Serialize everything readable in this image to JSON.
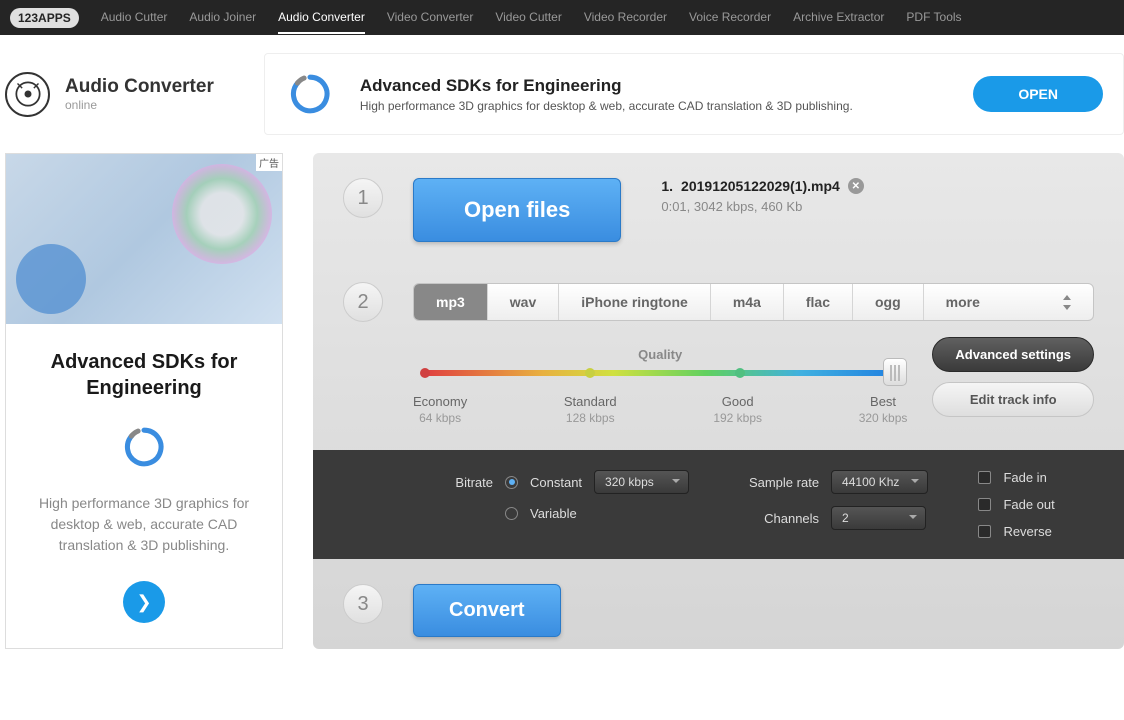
{
  "brand": "123APPS",
  "nav": [
    "Audio Cutter",
    "Audio Joiner",
    "Audio Converter",
    "Video Converter",
    "Video Cutter",
    "Video Recorder",
    "Voice Recorder",
    "Archive Extractor",
    "PDF Tools"
  ],
  "nav_active_index": 2,
  "header": {
    "title": "Audio Converter",
    "subtitle": "online"
  },
  "top_ad": {
    "title": "Advanced SDKs for Engineering",
    "desc": "High performance 3D graphics for desktop & web, accurate CAD translation & 3D publishing.",
    "cta": "OPEN"
  },
  "side_ad": {
    "badge": "广告",
    "title": "Advanced SDKs for Engineering",
    "desc": "High performance 3D graphics for desktop & web, accurate CAD translation & 3D publishing."
  },
  "step1": {
    "open_label": "Open files",
    "file_prefix": "1.",
    "file_name": "20191205122029(1).mp4",
    "file_meta": "0:01, 3042 kbps, 460 Kb"
  },
  "formats": [
    "mp3",
    "wav",
    "iPhone ringtone",
    "m4a",
    "flac",
    "ogg",
    "more"
  ],
  "format_active_index": 0,
  "quality": {
    "label": "Quality",
    "marks": [
      {
        "name": "Economy",
        "kbps": "64 kbps"
      },
      {
        "name": "Standard",
        "kbps": "128 kbps"
      },
      {
        "name": "Good",
        "kbps": "192 kbps"
      },
      {
        "name": "Best",
        "kbps": "320 kbps"
      }
    ]
  },
  "buttons": {
    "advanced": "Advanced settings",
    "edit": "Edit track info"
  },
  "advanced": {
    "bitrate_label": "Bitrate",
    "constant": "Constant",
    "variable": "Variable",
    "bitrate_value": "320 kbps",
    "sample_label": "Sample rate",
    "sample_value": "44100 Khz",
    "channels_label": "Channels",
    "channels_value": "2",
    "fade_in": "Fade in",
    "fade_out": "Fade out",
    "reverse": "Reverse"
  },
  "convert_label": "Convert"
}
